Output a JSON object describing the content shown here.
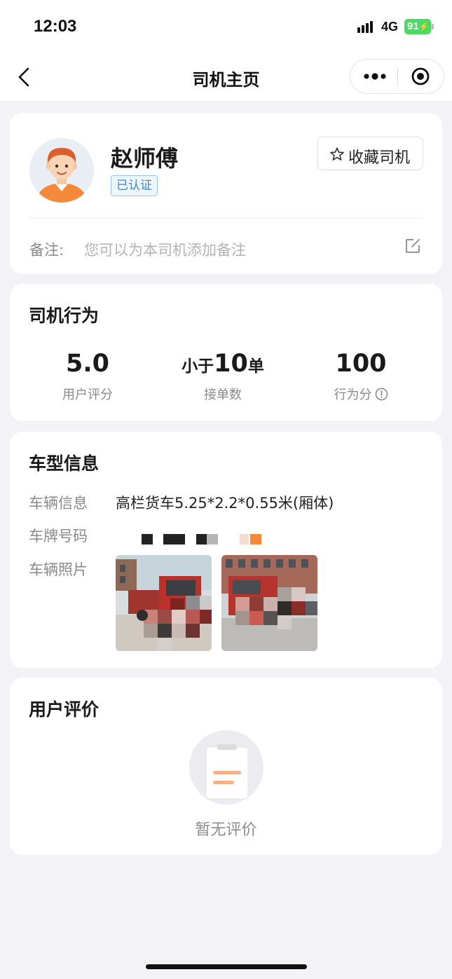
{
  "status_bar": {
    "time": "12:03",
    "network": "4G",
    "battery": "91",
    "icons": [
      "signal-icon",
      "battery-icon"
    ]
  },
  "nav": {
    "title": "司机主页",
    "icons": [
      "back-arrow-icon",
      "more-dots-icon",
      "close-target-icon"
    ]
  },
  "profile": {
    "name": "赵师傅",
    "badge": "已认证",
    "favorite_label": "收藏司机",
    "note_label": "备注:",
    "note_placeholder": "您可以为本司机添加备注",
    "icons": [
      "avatar-illustration",
      "star-icon",
      "edit-icon"
    ]
  },
  "behavior": {
    "title": "司机行为",
    "stats": [
      {
        "value": "5.0",
        "label": "用户评分"
      },
      {
        "prefix": "小于",
        "value": "10",
        "suffix": "单",
        "label": "接单数"
      },
      {
        "value": "100",
        "label": "行为分",
        "icon": "info-icon"
      }
    ]
  },
  "vehicle": {
    "title": "车型信息",
    "rows": [
      {
        "label": "车辆信息",
        "value": "高栏货车5.25*2.2*0.55米(厢体)"
      },
      {
        "label": "车牌号码",
        "value": ""
      },
      {
        "label": "车辆照片",
        "value": ""
      }
    ],
    "photos_count": 2
  },
  "reviews": {
    "title": "用户评价",
    "empty_text": "暂无评价",
    "icon": "empty-clipboard-icon"
  },
  "colors": {
    "accent_orange": "#f5893a",
    "badge_blue": "#3a87d6",
    "battery_green": "#4cd964",
    "page_bg": "#f3f3f6"
  }
}
